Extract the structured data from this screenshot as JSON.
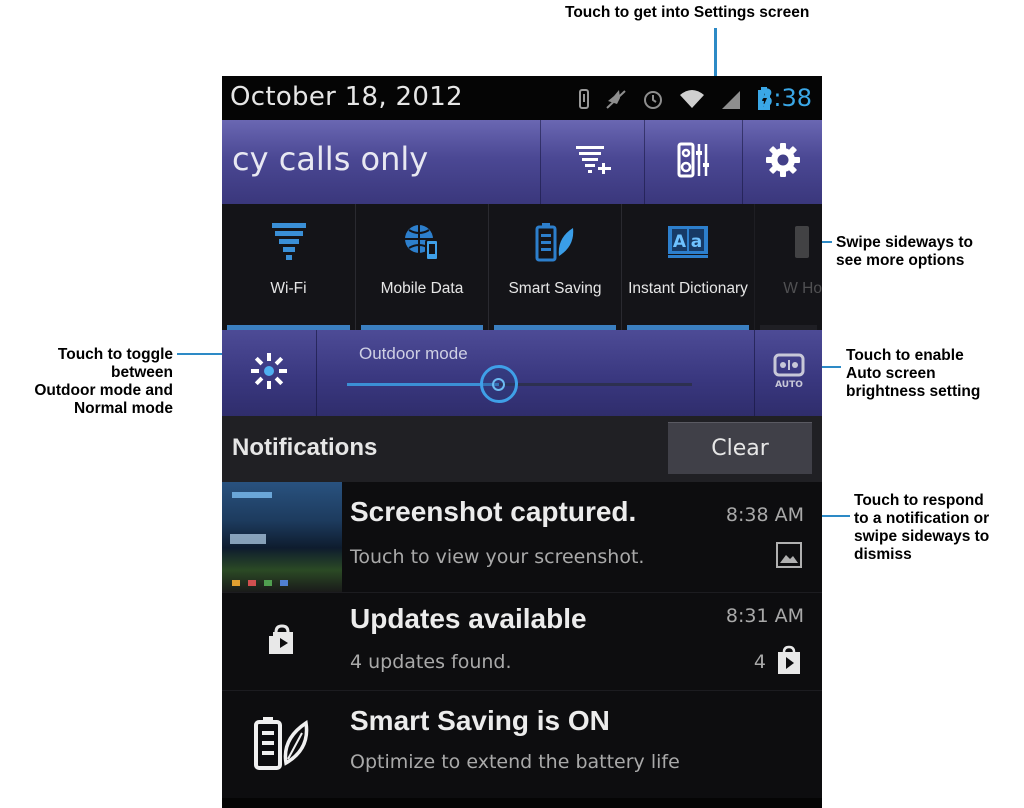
{
  "status_bar": {
    "date": "October 18, 2012",
    "time": "8:38",
    "icons": [
      "vibrate-icon",
      "mute-icon",
      "alarm-icon",
      "wifi-icon",
      "signal-icon",
      "battery-icon"
    ]
  },
  "carrier_row": {
    "text": "cy calls only",
    "buttons": [
      "quick-settings-filter-icon",
      "equalizer-icon",
      "gear-icon"
    ]
  },
  "quick_settings": [
    {
      "label": "Wi-Fi",
      "icon": "wifi-icon",
      "active": true
    },
    {
      "label": "Mobile Data",
      "icon": "globe-data-icon",
      "active": true
    },
    {
      "label": "Smart Saving",
      "icon": "leaf-battery-icon",
      "active": true
    },
    {
      "label": "Instant Dictionary",
      "icon": "dictionary-icon",
      "active": true
    },
    {
      "label": "W Ho",
      "icon": "hotspot-icon",
      "active": false
    }
  ],
  "brightness": {
    "label": "Outdoor mode",
    "level_fraction": 0.44,
    "auto_label": "AUTO"
  },
  "notifications_header": {
    "title": "Notifications",
    "clear_label": "Clear"
  },
  "notifications": [
    {
      "title": "Screenshot captured.",
      "subtitle": "Touch to view your screenshot.",
      "time": "8:38 AM",
      "right_icon": "picture-icon",
      "left": "screenshot-thumbnail"
    },
    {
      "title": "Updates available",
      "subtitle": "4 updates found.",
      "time": "8:31 AM",
      "count": "4",
      "right_icon": "play-store-icon",
      "left": "play-store-icon"
    },
    {
      "title": "Smart Saving is ON",
      "subtitle": "Optimize to extend the battery life",
      "left": "leaf-battery-icon"
    }
  ],
  "callouts": {
    "settings": "Touch to get into Settings screen",
    "swipe_line1": "Swipe sideways to",
    "swipe_line2": "see more options",
    "toggle_line1": "Touch to toggle",
    "toggle_line2": "between",
    "toggle_line3": "Outdoor mode and",
    "toggle_line4": "Normal mode",
    "auto_line1": "Touch to enable",
    "auto_line2": "Auto screen",
    "auto_line3": "brightness setting",
    "respond_line1": "Touch to respond",
    "respond_line2": "to a notification or",
    "respond_line3": "swipe sideways to",
    "respond_line4": "dismiss"
  },
  "colors": {
    "accent_blue": "#3aa7e6",
    "panel_purple": "#4b4894",
    "callout_line": "#2d8ac6"
  }
}
